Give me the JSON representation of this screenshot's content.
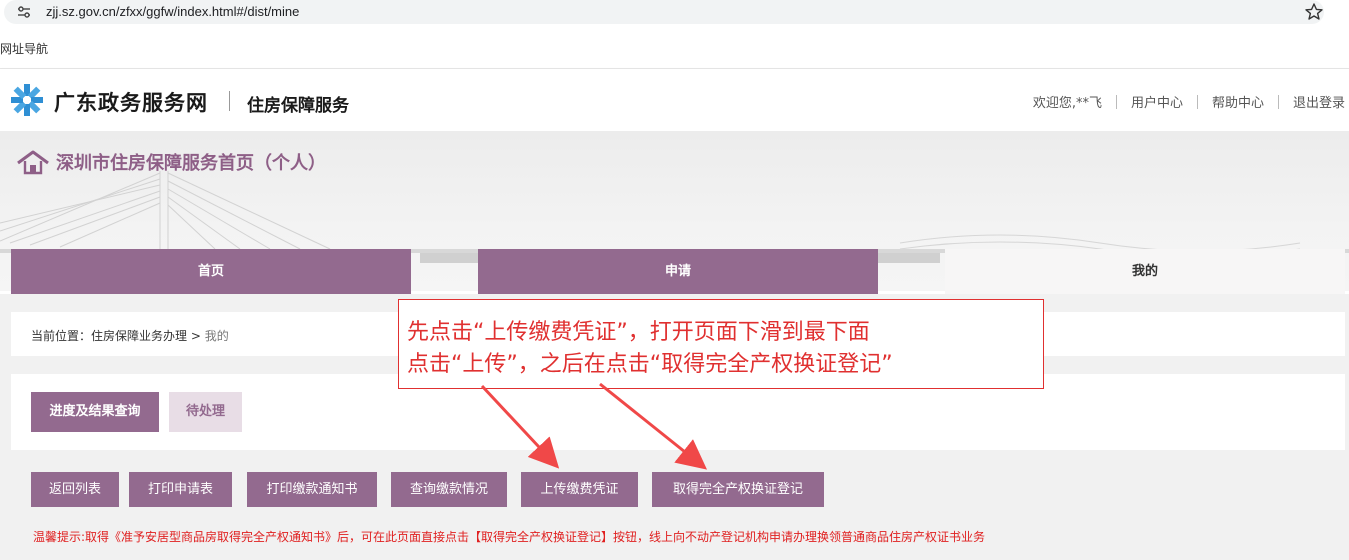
{
  "browser": {
    "url": "zjj.sz.gov.cn/zfxx/ggfw/index.html#/dist/mine",
    "bookmark": "网址导航"
  },
  "header": {
    "brand": "广东政务服务网",
    "service": "住房保障服务",
    "welcome": "欢迎您,**飞",
    "user_center": "用户中心",
    "help_center": "帮助中心",
    "logout": "退出登录"
  },
  "banner": {
    "title": "深圳市住房保障服务首页（个人）"
  },
  "tabs": {
    "home": "首页",
    "apply": "申请",
    "mine": "我的"
  },
  "breadcrumb": {
    "prefix": "当前位置：住房保障业务办理 >",
    "current": "我的"
  },
  "panel": {
    "progress": "进度及结果查询",
    "pending": "待处理"
  },
  "actions": {
    "back": "返回列表",
    "print_app": "打印申请表",
    "print_notice": "打印缴款通知书",
    "query_payment": "查询缴款情况",
    "upload_voucher": "上传缴费凭证",
    "get_certificate": "取得完全产权换证登记"
  },
  "tip": "温馨提示:取得《准予安居型商品房取得完全产权通知书》后，可在此页面直接点击【取得完全产权换证登记】按钮，线上向不动产登记机构申请办理换领普通商品住房产权证书业务",
  "annotation": {
    "line1": "先点击“上传缴费凭证”，打开页面下滑到最下面",
    "line2": "点击“上传”，之后在点击“取得完全产权换证登记”"
  },
  "colors": {
    "primary": "#936a8f",
    "pending_bg": "#e8dde6",
    "warning": "#e02020",
    "annotation": "#e03030"
  }
}
